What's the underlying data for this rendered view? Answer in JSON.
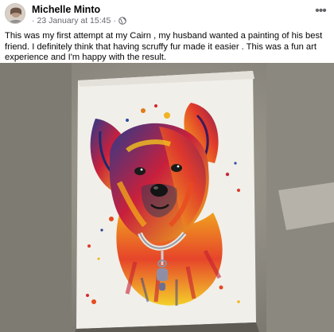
{
  "post": {
    "author": "Michelle Minto",
    "timestamp": "23 January at 15:45",
    "separator": "·",
    "dot_before": "·",
    "more_label": "•••",
    "text": "This was my first attempt at my Cairn , my husband wanted a painting of his best friend. I definitely think that having scruffy fur made it easier . This was a fun art experience and I'm happy with the result."
  },
  "icons": {
    "avatar": "avatar",
    "privacy": "globe-icon",
    "more": "more-options-icon"
  },
  "colors": {
    "author": "#050505",
    "meta": "#65676b",
    "photo_bg": "#8a877e",
    "paper": "#f3f1ec"
  }
}
